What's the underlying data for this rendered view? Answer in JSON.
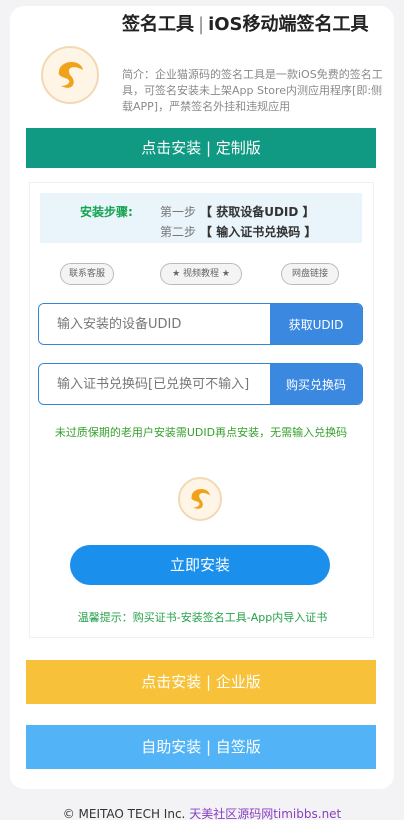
{
  "header": {
    "title_main": "签名工具",
    "title_sep": "|",
    "title_sub": "iOS移动端签名工具",
    "description": "简介：企业猫源码的签名工具是一款iOS免费的签名工具，可签名安装未上架App Store内测应用程序[即:侧载APP]，严禁签名外挂和违规应用"
  },
  "top_bar": {
    "label": "点击安装 | 定制版"
  },
  "steps": {
    "heading": "安装步骤:",
    "step1_prefix": "第一步",
    "step1_text": "【 获取设备UDID 】",
    "step2_prefix": "第二步",
    "step2_text": "【 输入证书兑换码 】"
  },
  "links": {
    "contact": "联系客服",
    "video": "★ 视频教程 ★",
    "netdisk": "网盘链接"
  },
  "udid": {
    "placeholder": "输入安装的设备UDID",
    "button": "获取UDID"
  },
  "code": {
    "placeholder": "输入证书兑换码[已兑换可不输入]",
    "button": "购买兑换码"
  },
  "notice": "未过质保期的老用户安装需UDID再点安装，无需输入兑换码",
  "install": {
    "label": "立即安装"
  },
  "tip": "温馨提示：购买证书-安装签名工具-App内导入证书",
  "enterprise_bar": {
    "label": "点击安装 | 企业版"
  },
  "selfsign_bar": {
    "label": "自助安装 | 自签版"
  },
  "footer": {
    "copyright": "© MEITAO TECH Inc.",
    "link": "天美社区源码网timibbs.net"
  },
  "colors": {
    "green_bar": "#119a83",
    "yellow_bar": "#f7c13a",
    "blue_bar": "#52b4f7",
    "primary_button": "#1a8fec",
    "logo_accent": "#f0a21b"
  },
  "icons": {
    "app_logo": "swirl-logo-icon",
    "mini_logo": "swirl-logo-icon"
  }
}
